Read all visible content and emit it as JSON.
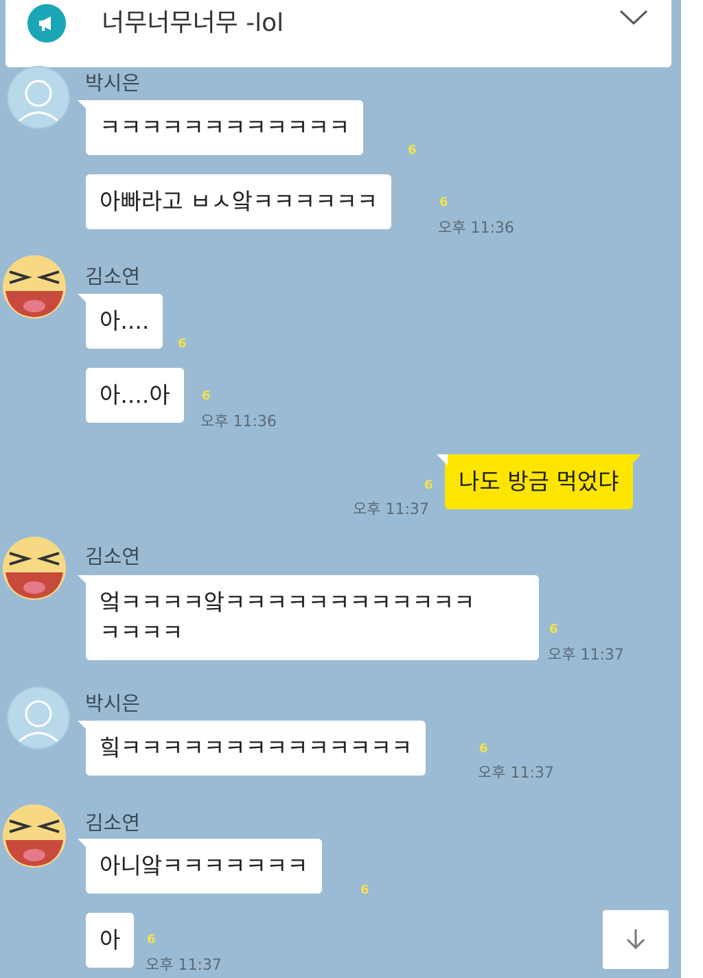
{
  "notice": {
    "title": "너무너무너무 -lol",
    "icon": "megaphone-icon",
    "chevron": "chevron-down-icon"
  },
  "colors": {
    "chat_bg": "#9bbbd4",
    "my_bubble": "#fee500",
    "other_bubble": "#ffffff",
    "unread": "#f2e24b"
  },
  "groups": [
    {
      "sender": "박시은",
      "avatar": "default-profile-icon",
      "messages": [
        {
          "text": "ㅋㅋㅋㅋㅋㅋㅋㅋㅋㅋㅋㅋ",
          "unread": "6",
          "time": ""
        },
        {
          "text": "아빠라고 ㅂㅅ앜ㅋㅋㅋㅋㅋㅋ",
          "unread": "6",
          "time": "오후 11:36"
        }
      ]
    },
    {
      "sender": "김소연",
      "avatar": "squinting-face-icon",
      "messages": [
        {
          "text": "아....",
          "unread": "6",
          "time": ""
        },
        {
          "text": "아....아",
          "unread": "6",
          "time": "오후 11:36"
        }
      ]
    },
    {
      "sender": "",
      "mine": true,
      "messages": [
        {
          "text": "나도 방금 먹었댜",
          "unread": "6",
          "time": "오후 11:37"
        }
      ]
    },
    {
      "sender": "김소연",
      "avatar": "squinting-face-icon",
      "messages": [
        {
          "text": "엌ㅋㅋㅋㅋ앜ㅋㅋㅋㅋㅋㅋㅋㅋㅋㅋㅋㅋ\nㅋㅋㅋㅋ",
          "unread": "6",
          "time": "오후 11:37"
        }
      ]
    },
    {
      "sender": "박시은",
      "avatar": "default-profile-icon",
      "messages": [
        {
          "text": "힠ㅋㅋㅋㅋㅋㅋㅋㅋㅋㅋㅋㅋㅋㅋ",
          "unread": "6",
          "time": "오후 11:37"
        }
      ]
    },
    {
      "sender": "김소연",
      "avatar": "squinting-face-icon",
      "messages": [
        {
          "text": "아니앜ㅋㅋㅋㅋㅋㅋㅋ",
          "unread": "6",
          "time": ""
        },
        {
          "text": "아",
          "unread": "6",
          "time": "오후 11:37"
        }
      ]
    }
  ],
  "scroll_button": {
    "icon": "arrow-down-icon"
  }
}
